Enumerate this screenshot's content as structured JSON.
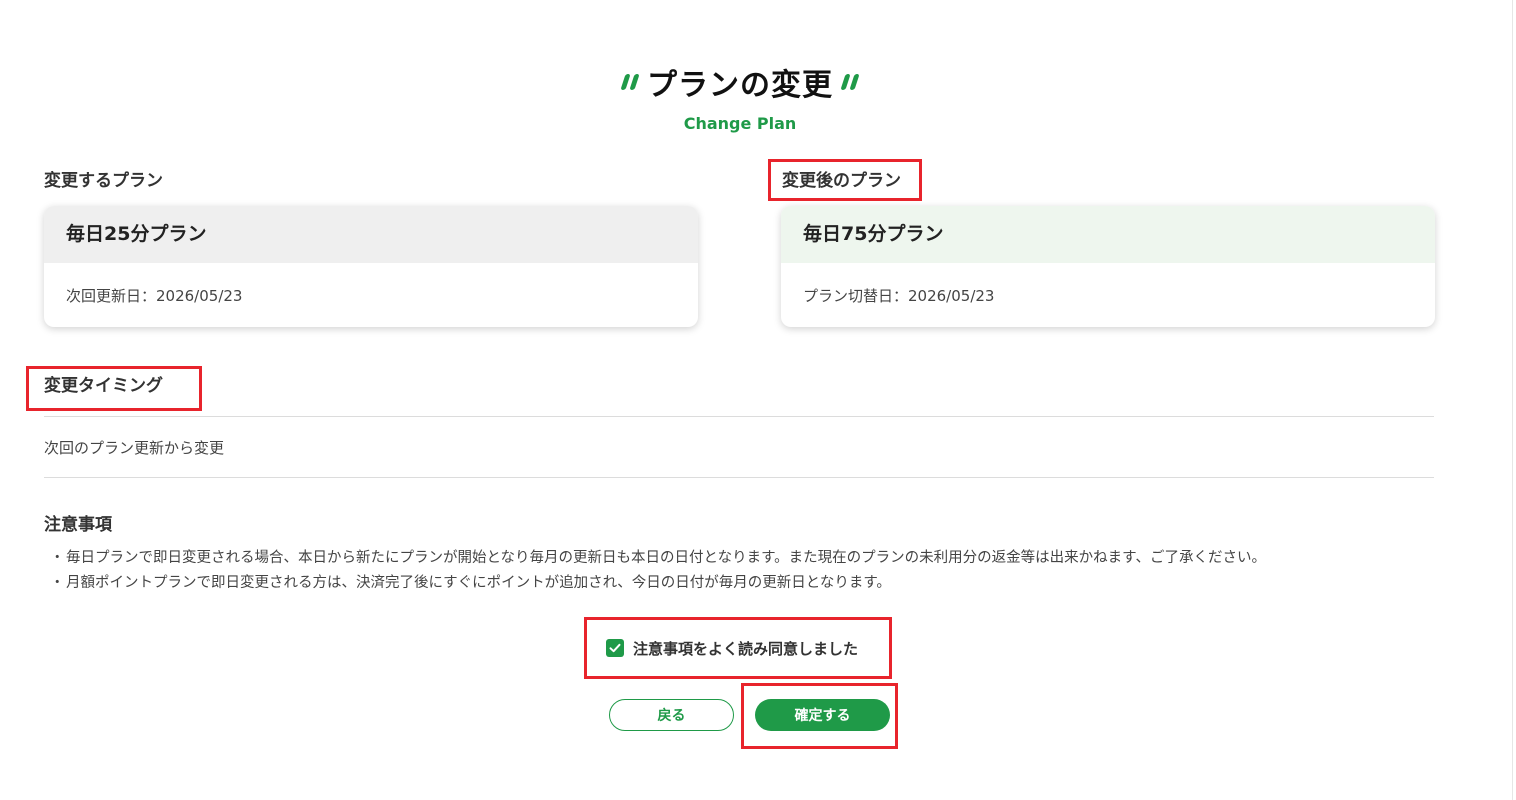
{
  "header": {
    "title": "プランの変更",
    "subtitle": "Change Plan"
  },
  "current_plan": {
    "section_label": "変更するプラン",
    "plan_name": "毎日25分プラン",
    "detail": "次回更新日：2026/05/23"
  },
  "new_plan": {
    "section_label": "変更後のプラン",
    "plan_name": "毎日75分プラン",
    "detail": "プラン切替日：2026/05/23"
  },
  "timing": {
    "section_label": "変更タイミング",
    "value": "次回のプラン更新から変更"
  },
  "notes": {
    "section_label": "注意事項",
    "bullet": "・",
    "items": [
      "毎日プランで即日変更される場合、本日から新たにプランが開始となり毎月の更新日も本日の日付となります。また現在のプランの未利用分の返金等は出来かねます、ご了承ください。",
      "月額ポイントプランで即日変更される方は、決済完了後にすぐにポイントが追加され、今日の日付が毎月の更新日となります。"
    ]
  },
  "agreement": {
    "label": "注意事項をよく読み同意しました",
    "checked": true
  },
  "buttons": {
    "back_label": "戻る",
    "confirm_label": "確定する"
  },
  "colors": {
    "accent": "#1f9a48",
    "highlight": "#e8242c"
  }
}
